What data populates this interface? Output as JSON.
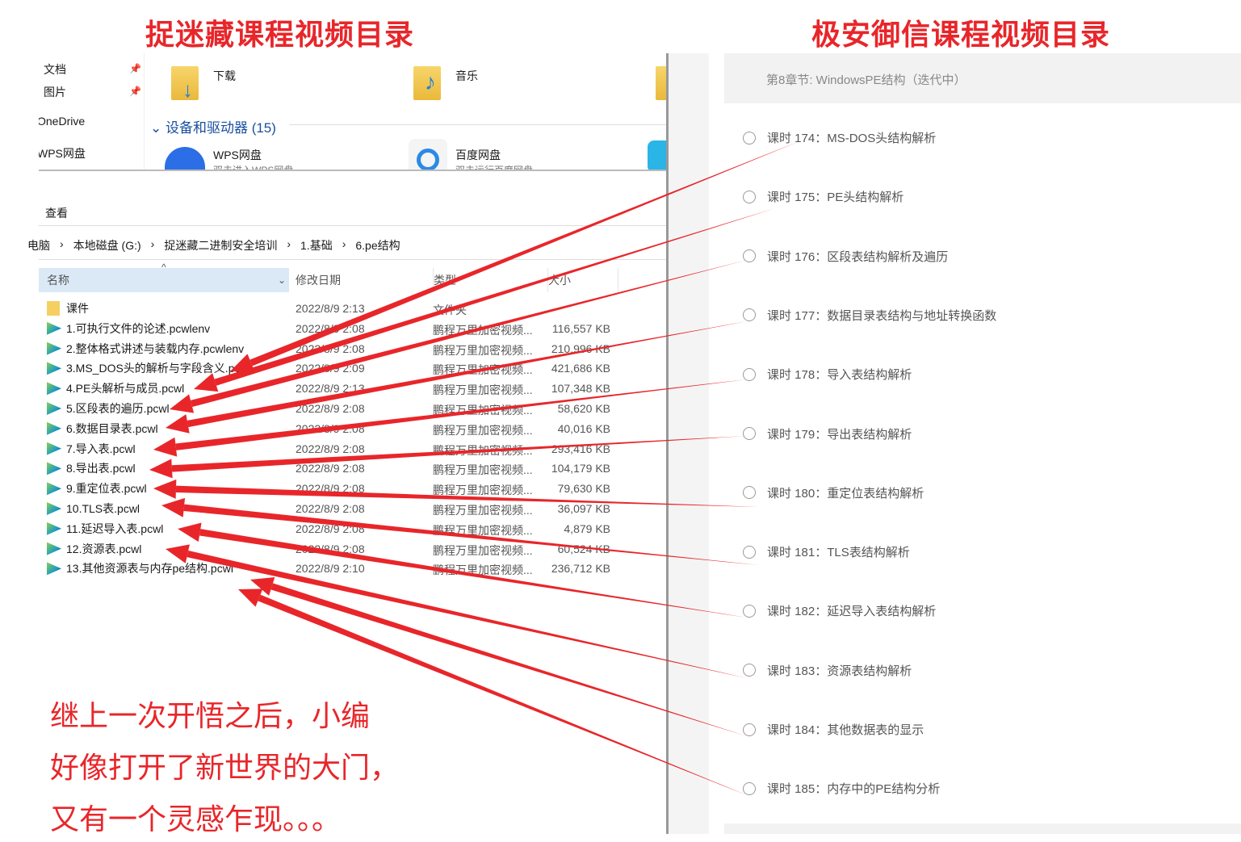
{
  "titles": {
    "left": "捉迷藏课程视频目录",
    "right": "极安御信课程视频目录"
  },
  "explorer": {
    "nav": [
      {
        "label": "文档",
        "pinned": true
      },
      {
        "label": "图片",
        "pinned": true
      },
      {
        "label": "OneDrive"
      },
      {
        "label": "WPS网盘"
      }
    ],
    "tiles": [
      {
        "label": "下载",
        "icon": "download-folder-icon"
      },
      {
        "label": "音乐",
        "icon": "music-folder-icon"
      }
    ],
    "section": "设备和驱动器 (15)",
    "drives": [
      {
        "label": "WPS网盘",
        "sub": "双击进入WPS网盘"
      },
      {
        "label": "百度网盘",
        "sub": "双击运行百度网盘"
      }
    ],
    "ribbon_tab": "查看",
    "breadcrumb": [
      "电脑",
      "本地磁盘 (G:)",
      "捉迷藏二进制安全培训",
      "1.基础",
      "6.pe结构"
    ],
    "columns": {
      "name": "名称",
      "date": "修改日期",
      "type": "类型",
      "size": "大小"
    },
    "files": [
      {
        "name": "课件",
        "date": "2022/8/9 2:13",
        "type": "文件夹",
        "size": "",
        "folder": true
      },
      {
        "name": "1.可执行文件的论述.pcwlenv",
        "date": "2022/8/9 2:08",
        "type": "鹏程万里加密视频...",
        "size": "116,557 KB"
      },
      {
        "name": "2.整体格式讲述与装载内存.pcwlenv",
        "date": "2022/8/9 2:08",
        "type": "鹏程万里加密视频...",
        "size": "210,996 KB"
      },
      {
        "name": "3.MS_DOS头的解析与字段含义.pcwl",
        "date": "2022/8/9 2:09",
        "type": "鹏程万里加密视频...",
        "size": "421,686 KB"
      },
      {
        "name": "4.PE头解析与成员.pcwl",
        "date": "2022/8/9 2:13",
        "type": "鹏程万里加密视频...",
        "size": "107,348 KB"
      },
      {
        "name": "5.区段表的遍历.pcwl",
        "date": "2022/8/9 2:08",
        "type": "鹏程万里加密视频...",
        "size": "58,620 KB"
      },
      {
        "name": "6.数据目录表.pcwl",
        "date": "2022/8/9 2:08",
        "type": "鹏程万里加密视频...",
        "size": "40,016 KB"
      },
      {
        "name": "7.导入表.pcwl",
        "date": "2022/8/9 2:08",
        "type": "鹏程万里加密视频...",
        "size": "293,416 KB"
      },
      {
        "name": "8.导出表.pcwl",
        "date": "2022/8/9 2:08",
        "type": "鹏程万里加密视频...",
        "size": "104,179 KB"
      },
      {
        "name": "9.重定位表.pcwl",
        "date": "2022/8/9 2:08",
        "type": "鹏程万里加密视频...",
        "size": "79,630 KB"
      },
      {
        "name": "10.TLS表.pcwl",
        "date": "2022/8/9 2:08",
        "type": "鹏程万里加密视频...",
        "size": "36,097 KB"
      },
      {
        "name": "11.延迟导入表.pcwl",
        "date": "2022/8/9 2:08",
        "type": "鹏程万里加密视频...",
        "size": "4,879 KB"
      },
      {
        "name": "12.资源表.pcwl",
        "date": "2022/8/9 2:08",
        "type": "鹏程万里加密视频...",
        "size": "60,524 KB"
      },
      {
        "name": "13.其他资源表与内存pe结构.pcwl",
        "date": "2022/8/9 2:10",
        "type": "鹏程万里加密视频...",
        "size": "236,712 KB"
      }
    ]
  },
  "course": {
    "chapter": "第8章节: WindowsPE结构（迭代中）",
    "lessons": [
      "课时 174：MS-DOS头结构解析",
      "课时 175：PE头结构解析",
      "课时 176：区段表结构解析及遍历",
      "课时 177：数据目录表结构与地址转换函数",
      "课时 178：导入表结构解析",
      "课时 179：导出表结构解析",
      "课时 180：重定位表结构解析",
      "课时 181：TLS表结构解析",
      "课时 182：延迟导入表结构解析",
      "课时 183：资源表结构解析",
      "课时 184：其他数据表的显示",
      "课时 185：内存中的PE结构分析"
    ]
  },
  "caption": [
    "继上一次开悟之后，小编",
    "好像打开了新世界的大门，",
    "又有一个灵感乍现。。。"
  ],
  "colors": {
    "annotation": "#e8262a",
    "header_bg": "#dbe9f7",
    "chapter_bg": "#f2f2f2"
  }
}
